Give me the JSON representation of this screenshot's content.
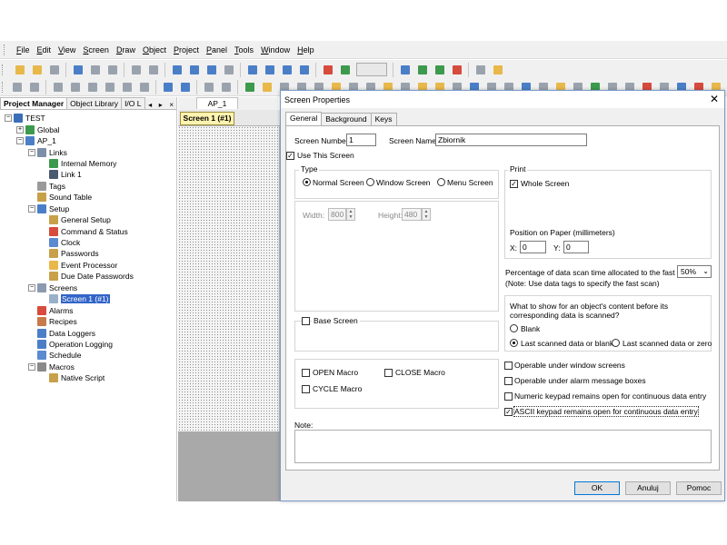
{
  "menubar": {
    "items": [
      {
        "underline": "F",
        "rest": "ile"
      },
      {
        "underline": "E",
        "rest": "dit"
      },
      {
        "underline": "V",
        "rest": "iew"
      },
      {
        "underline": "S",
        "rest": "creen"
      },
      {
        "underline": "D",
        "rest": "raw"
      },
      {
        "underline": "O",
        "rest": "bject"
      },
      {
        "underline": "P",
        "rest": "roject"
      },
      {
        "underline": "P",
        "rest": "anel"
      },
      {
        "underline": "T",
        "rest": "ools"
      },
      {
        "underline": "W",
        "rest": "indow"
      },
      {
        "underline": "H",
        "rest": "elp"
      }
    ]
  },
  "left_panel": {
    "tabs": [
      "Project Manager",
      "Object Library",
      "I/O L"
    ],
    "tab_controls": [
      "◂",
      "▸",
      "×"
    ],
    "tree": [
      {
        "label": "TEST",
        "level": 0,
        "exp": "−",
        "icon": "#3a6fb7"
      },
      {
        "label": "Global",
        "level": 1,
        "exp": "+",
        "icon": "#3c9a4c"
      },
      {
        "label": "AP_1",
        "level": 1,
        "exp": "−",
        "icon": "#4a7fc8"
      },
      {
        "label": "Links",
        "level": 2,
        "exp": "−",
        "icon": "#7c8ea8"
      },
      {
        "label": "Internal Memory",
        "level": 3,
        "exp": "",
        "icon": "#3c9a4c"
      },
      {
        "label": "Link 1",
        "level": 3,
        "exp": "",
        "icon": "#4a5a70"
      },
      {
        "label": "Tags",
        "level": 2,
        "exp": "",
        "icon": "#9a9a9a"
      },
      {
        "label": "Sound Table",
        "level": 2,
        "exp": "",
        "icon": "#c8a04a"
      },
      {
        "label": "Setup",
        "level": 2,
        "exp": "−",
        "icon": "#4a7fc8"
      },
      {
        "label": "General Setup",
        "level": 3,
        "exp": "",
        "icon": "#c8a04a"
      },
      {
        "label": "Command & Status",
        "level": 3,
        "exp": "",
        "icon": "#d64b3c"
      },
      {
        "label": "Clock",
        "level": 3,
        "exp": "",
        "icon": "#5a8ad0"
      },
      {
        "label": "Passwords",
        "level": 3,
        "exp": "",
        "icon": "#c8a04a"
      },
      {
        "label": "Event Processor",
        "level": 3,
        "exp": "",
        "icon": "#e8b84a"
      },
      {
        "label": "Due Date Passwords",
        "level": 3,
        "exp": "",
        "icon": "#c8a04a"
      },
      {
        "label": "Screens",
        "level": 2,
        "exp": "−",
        "icon": "#8a9ab0"
      },
      {
        "label": "Screen 1 (#1)",
        "level": 3,
        "exp": "",
        "icon": "#9ab0c8",
        "selected": true
      },
      {
        "label": "Alarms",
        "level": 2,
        "exp": "",
        "icon": "#d64b3c"
      },
      {
        "label": "Recipes",
        "level": 2,
        "exp": "",
        "icon": "#c87a4a"
      },
      {
        "label": "Data Loggers",
        "level": 2,
        "exp": "",
        "icon": "#4a7fc8"
      },
      {
        "label": "Operation Logging",
        "level": 2,
        "exp": "",
        "icon": "#4a7fc8"
      },
      {
        "label": "Schedule",
        "level": 2,
        "exp": "",
        "icon": "#5a8ad0"
      },
      {
        "label": "Macros",
        "level": 2,
        "exp": "−",
        "icon": "#8a8a8a"
      },
      {
        "label": "Native Script",
        "level": 3,
        "exp": "",
        "icon": "#c8a04a"
      }
    ]
  },
  "editor": {
    "doc_tab": "AP_1",
    "screen_tab": "Screen 1 (#1)"
  },
  "dialog": {
    "title": "Screen Properties",
    "close": "✕",
    "tabs": [
      "General",
      "Background",
      "Keys"
    ],
    "screen_number_label": "Screen Number:",
    "screen_number": "1",
    "screen_name_label": "Screen Name:",
    "screen_name": "Zbiornik",
    "use_this_screen": "Use This Screen",
    "type_title": "Type",
    "type_options": [
      "Normal Screen",
      "Window Screen",
      "Menu Screen"
    ],
    "width_label": "Width:",
    "width": "800",
    "height_label": "Height:",
    "height": "480",
    "base_screen": "Base Screen",
    "open_macro": "OPEN Macro",
    "close_macro": "CLOSE Macro",
    "cycle_macro": "CYCLE Macro",
    "print_title": "Print",
    "whole_screen": "Whole Screen",
    "position_label": "Position on Paper (millimeters)",
    "x_label": "X:",
    "x_value": "0",
    "y_label": "Y:",
    "y_value": "0",
    "scan_label": "Percentage of data scan time allocated to the fast scan:",
    "scan_value": "50%",
    "scan_note": "(Note: Use data tags to specify the fast scan)",
    "show_question": "What to show for an object's content before its corresponding data is scanned?",
    "blank": "Blank",
    "last_or_blank": "Last scanned data or blank",
    "last_or_zero": "Last scanned data or zero",
    "operable_window": "Operable under window screens",
    "operable_alarm": "Operable under alarm message boxes",
    "numeric_keypad": "Numeric keypad remains open for continuous data entry",
    "ascii_keypad": "ASCII keypad remains open for continuous data entry",
    "note_label": "Note:",
    "ok": "OK",
    "cancel": "Anuluj",
    "help": "Pomoc"
  }
}
